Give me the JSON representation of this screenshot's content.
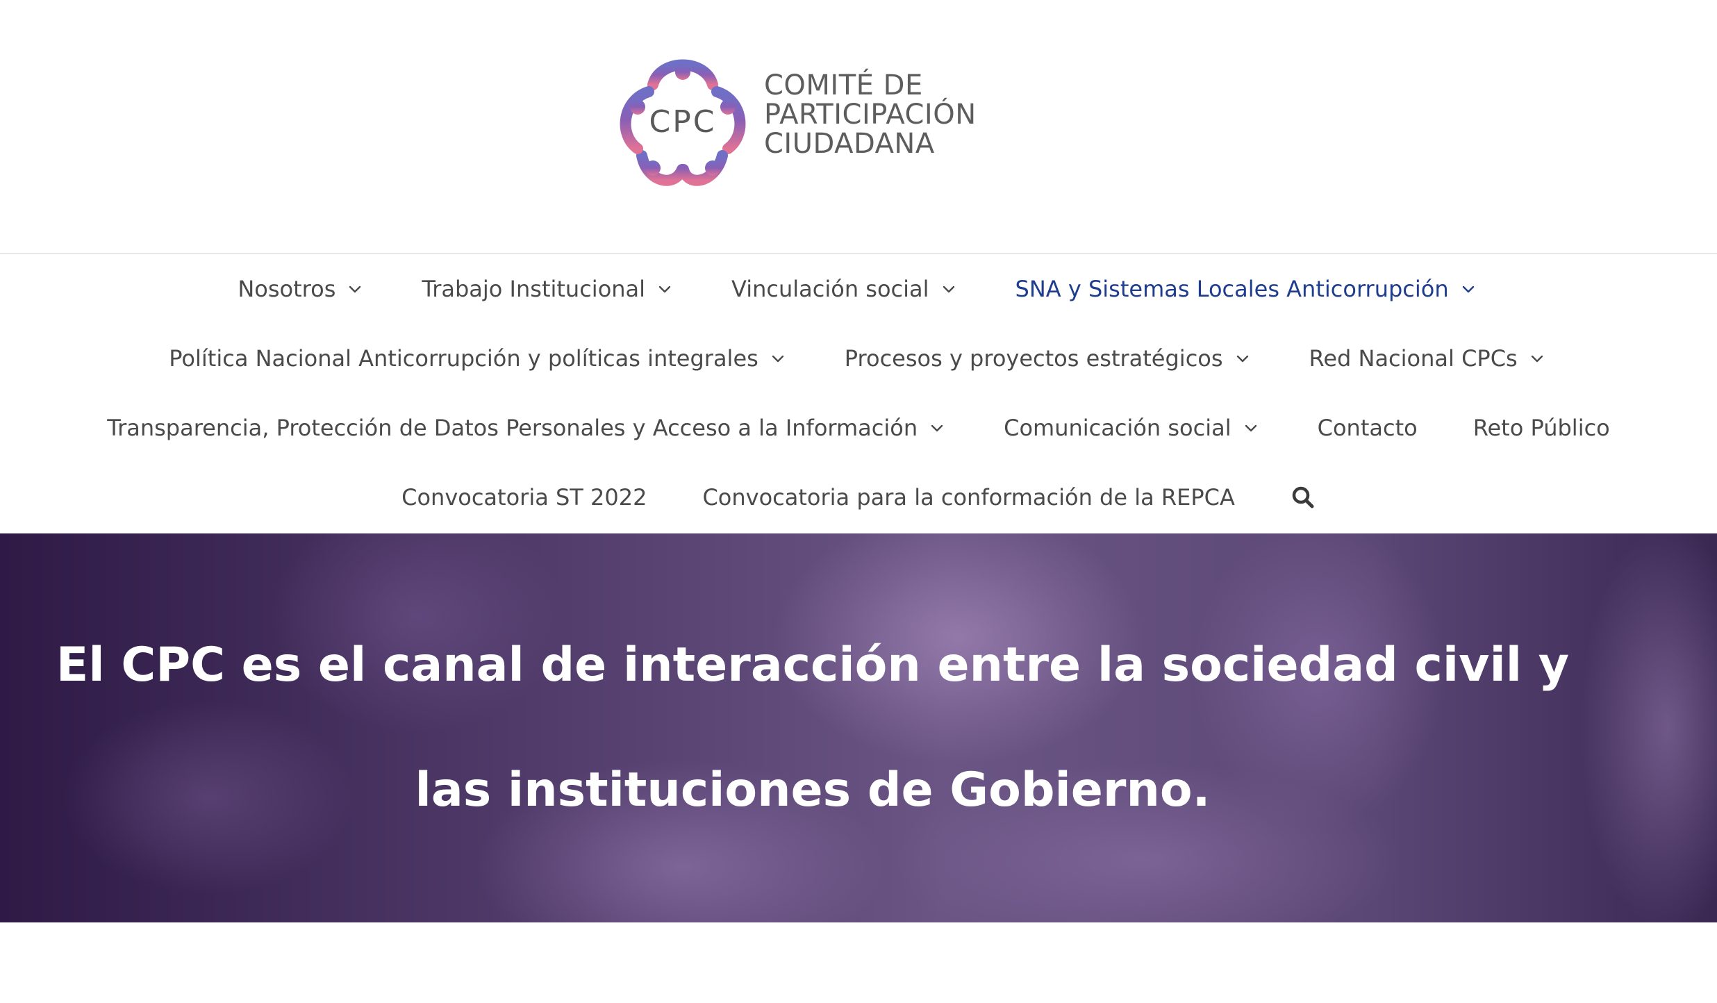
{
  "logo": {
    "mark_text": "CPC",
    "lines": [
      "COMITÉ DE",
      "PARTICIPACIÓN",
      "CIUDADANA"
    ]
  },
  "nav": {
    "rows": [
      [
        {
          "label": "Nosotros",
          "has_dropdown": true
        },
        {
          "label": "Trabajo Institucional",
          "has_dropdown": true
        },
        {
          "label": "Vinculación social",
          "has_dropdown": true
        },
        {
          "label": "SNA y Sistemas Locales Anticorrupción",
          "has_dropdown": true,
          "active": true
        }
      ],
      [
        {
          "label": "Política Nacional Anticorrupción y políticas integrales",
          "has_dropdown": true
        },
        {
          "label": "Procesos y proyectos estratégicos",
          "has_dropdown": true
        },
        {
          "label": "Red Nacional CPCs",
          "has_dropdown": true
        }
      ],
      [
        {
          "label": "Transparencia, Protección de Datos Personales y Acceso a la Información",
          "has_dropdown": true
        },
        {
          "label": "Comunicación social",
          "has_dropdown": true
        },
        {
          "label": "Contacto",
          "has_dropdown": false
        },
        {
          "label": "Reto Público",
          "has_dropdown": false
        }
      ],
      [
        {
          "label": "Convocatoria ST 2022",
          "has_dropdown": false
        },
        {
          "label": "Convocatoria para la conformación de la REPCA",
          "has_dropdown": false
        }
      ]
    ],
    "search_icon": "search-icon"
  },
  "hero": {
    "title": "El CPC es el canal de interacción entre la sociedad civil y las instituciones de Gobierno."
  },
  "colors": {
    "nav_text": "#4a4a4a",
    "nav_active": "#1f3d8f",
    "logo_purple": "#6b5bb0",
    "logo_pink": "#d6678f",
    "hero_text": "#ffffff"
  }
}
